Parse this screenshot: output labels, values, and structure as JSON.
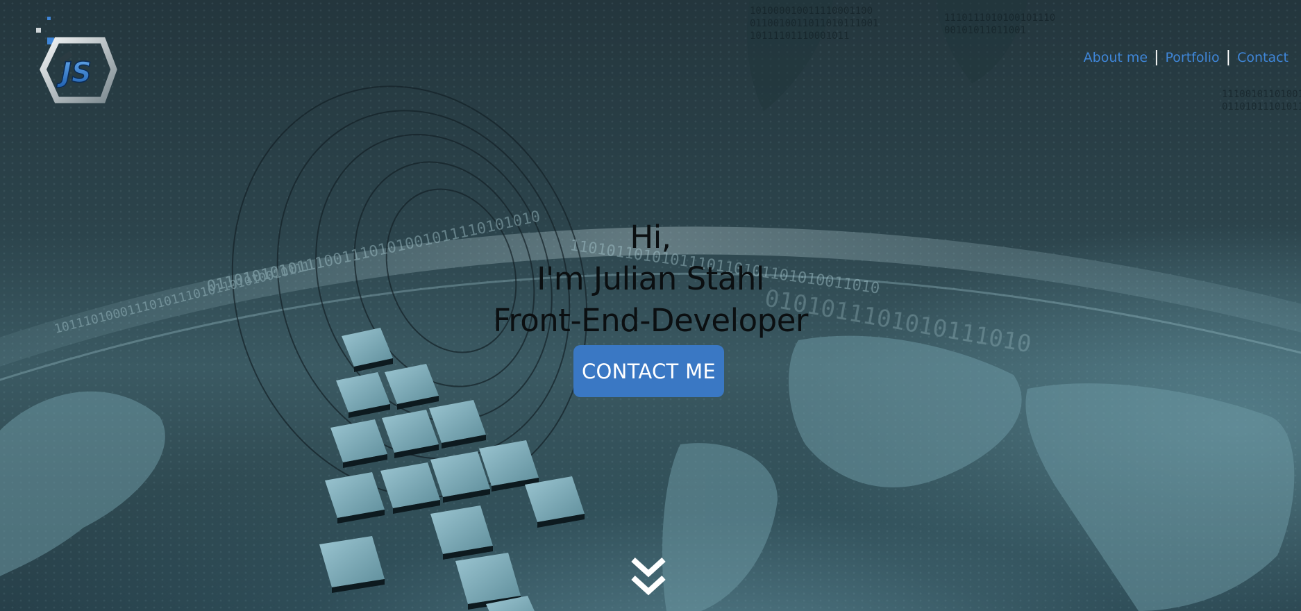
{
  "logo": {
    "initials": "JS",
    "icon": "js-hexagon-logo"
  },
  "nav": {
    "items": [
      {
        "label": "About me"
      },
      {
        "label": "Portfolio"
      },
      {
        "label": "Contact"
      }
    ],
    "separator": "|"
  },
  "hero": {
    "line1": "Hi,",
    "line2": "I'm Julian Stahl",
    "line3": "Front-End-Developer",
    "cta_label": "CONTACT ME",
    "scroll_icon": "double-chevron-down-icon"
  },
  "colors": {
    "link": "#3f86d8",
    "cta_bg": "#3a78c4",
    "headline": "#0b0f11"
  }
}
